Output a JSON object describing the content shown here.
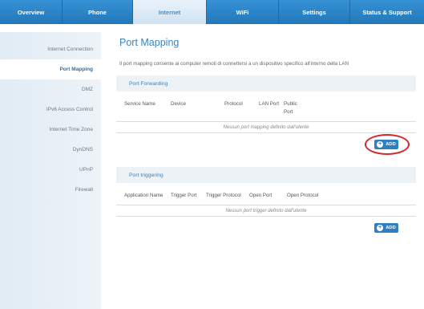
{
  "nav": {
    "tabs": [
      {
        "label": "Overview"
      },
      {
        "label": "Phone"
      },
      {
        "label": "Internet",
        "active": true
      },
      {
        "label": "WiFi"
      },
      {
        "label": "Settings"
      },
      {
        "label": "Status & Support"
      }
    ]
  },
  "sidebar": {
    "items": [
      {
        "label": "Internet Connection"
      },
      {
        "label": "Port Mapping",
        "active": true
      },
      {
        "label": "DMZ"
      },
      {
        "label": "IPv6 Access Control"
      },
      {
        "label": "Internet Time Zone"
      },
      {
        "label": "DynDNS"
      },
      {
        "label": "UPnP"
      },
      {
        "label": "Firewall"
      }
    ]
  },
  "main": {
    "title": "Port Mapping",
    "description": "Il port mapping consente ai computer remoti di connettersi a un dispositivo specifico all'interno della LAN",
    "forwarding": {
      "section_title": "Port Forwarding",
      "columns": [
        "Service Name",
        "Device",
        "Protocol",
        "LAN Port",
        "Public Port"
      ],
      "empty_message": "Nessun port mapping definito dall'utente",
      "add_label": "ADD"
    },
    "triggering": {
      "section_title": "Port triggering",
      "columns": [
        "Application Name",
        "Trigger Port",
        "Trigger Protocol",
        "Open Port",
        "Open Protocol"
      ],
      "empty_message": "Nessun port trigger definito dall'utente",
      "add_label": "ADD"
    }
  },
  "colors": {
    "nav_blue": "#2a7fc1",
    "accent": "#3b83bf",
    "highlight": "#d6262e"
  }
}
